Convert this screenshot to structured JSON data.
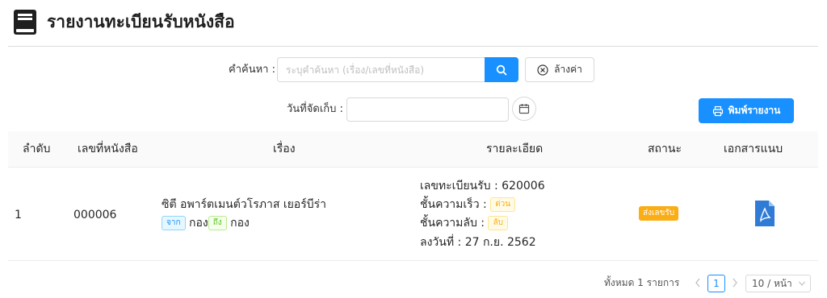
{
  "header": {
    "title": "รายงานทะเบียนรับหนังสือ",
    "icon": "book-icon"
  },
  "filters": {
    "search_label": "คำค้นหา :",
    "search_placeholder": "ระบุคำค้นหา (เรื่อง/เลขที่หนังสือ)",
    "search_value": "",
    "clear_label": "ล้างค่า",
    "date_label": "วันที่จัดเก็บ :",
    "date_value": "",
    "print_label": "พิมพ์รายงาน"
  },
  "table": {
    "columns": [
      "ลำดับ",
      "เลขที่หนังสือ",
      "เรื่อง",
      "รายละเอียด",
      "สถานะ",
      "เอกสารแนบ"
    ],
    "rows": [
      {
        "order": "1",
        "doc_no": "000006",
        "subject": "ซิตี อพาร์ตเมนต์วโรภาส เยอร์บีร่า",
        "from_tag": "จาก",
        "from_value": "กอง",
        "to_tag": "ถึง",
        "to_value": "กอง",
        "reg_no": "เลขทะเบียนรับ : 620006",
        "urgency_label": "ชั้นความเร็ว :",
        "urgency_tag": "ด่วน",
        "secrecy_label": "ชั้นความลับ :",
        "secrecy_tag": "ลับ",
        "date": "ลงวันที่ : 27 ก.ย. 2562",
        "status": "ส่งเลขรับ",
        "attachment_icon": "pdf-file-icon"
      }
    ]
  },
  "pagination": {
    "total": "ทั้งหมด 1 รายการ",
    "current_page": "1",
    "page_size": "10 / หน้า"
  },
  "colors": {
    "primary": "#1890ff",
    "warning": "#faad14",
    "success": "#52c41a"
  }
}
